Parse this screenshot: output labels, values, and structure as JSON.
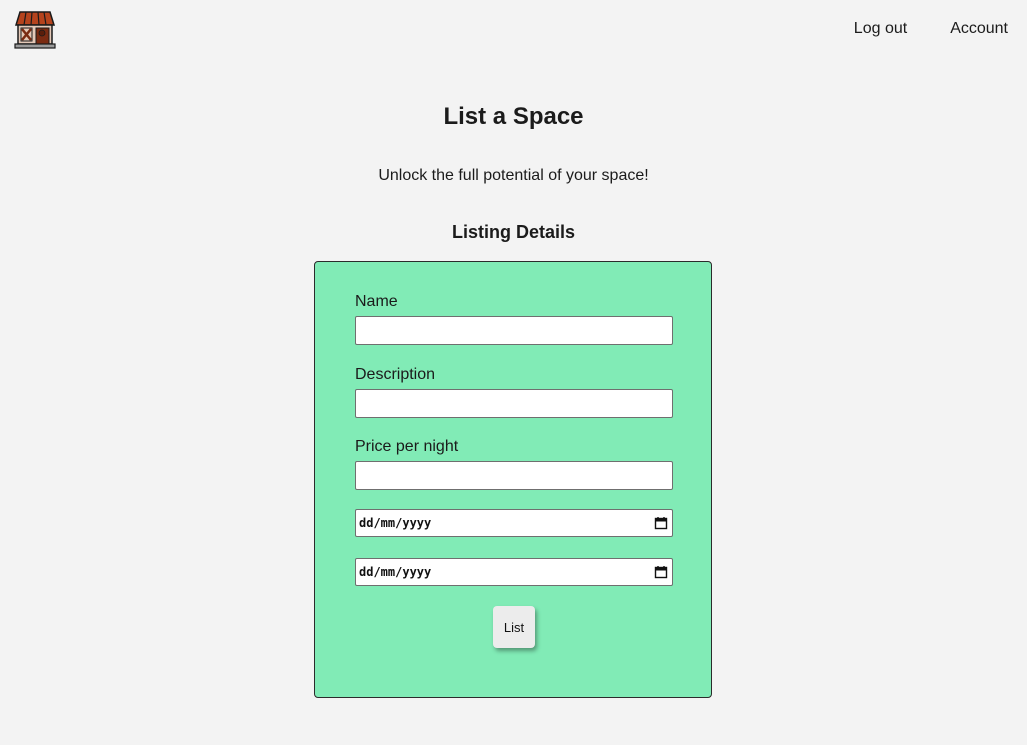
{
  "header": {
    "logo_icon": "shop-storefront-icon",
    "nav": {
      "logout_label": "Log out",
      "account_label": "Account"
    }
  },
  "main": {
    "title": "List a Space",
    "subtitle": "Unlock the full potential of your space!",
    "section_title": "Listing Details"
  },
  "form": {
    "name_label": "Name",
    "name_value": "",
    "description_label": "Description",
    "description_value": "",
    "price_label": "Price per night",
    "price_value": "",
    "start_date_placeholder": "dd/mm/yyyy",
    "end_date_placeholder": "dd/mm/yyyy",
    "calendar_icon": "calendar-icon",
    "submit_label": "List"
  },
  "colors": {
    "background": "#f3f3f3",
    "card": "#81ebb6",
    "card_border": "#2b2b2b",
    "button": "#ececec"
  }
}
